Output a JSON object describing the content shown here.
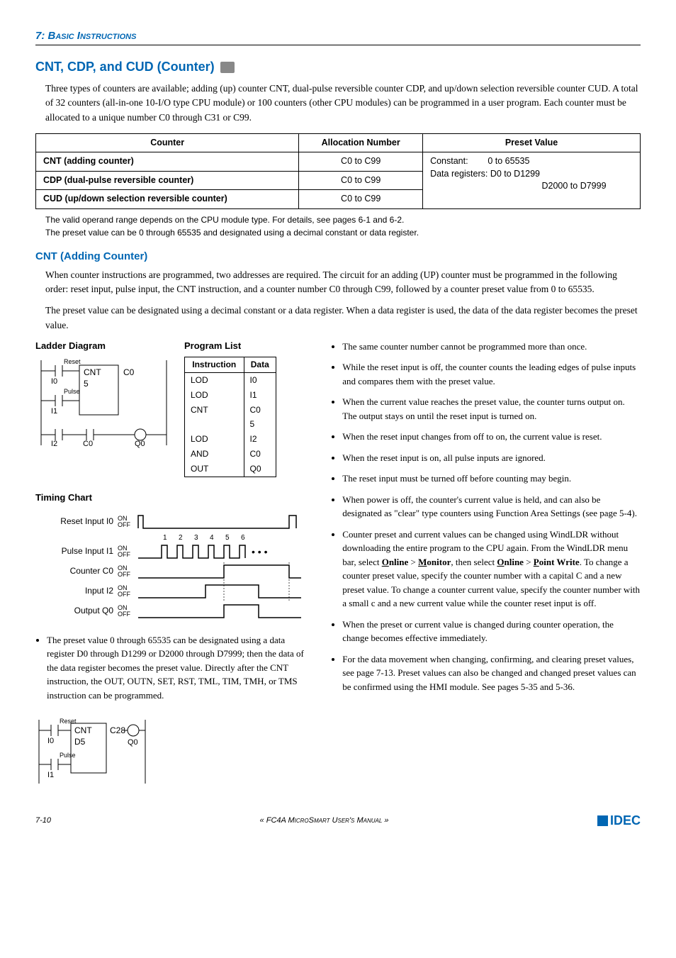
{
  "header": {
    "section_number": "7:",
    "section_title": "Basic Instructions"
  },
  "title": "CNT, CDP, and CUD (Counter)",
  "intro": "Three types of counters are available; adding (up) counter CNT, dual-pulse reversible counter CDP, and up/down selection reversible counter CUD. A total of 32 counters (all-in-one 10-I/O type CPU module) or 100 counters (other CPU modules) can be programmed in a user program. Each counter must be allocated to a unique number C0 through C31 or C99.",
  "counter_table": {
    "headers": [
      "Counter",
      "Allocation Number",
      "Preset Value"
    ],
    "rows": [
      {
        "counter": "CNT (adding counter)",
        "alloc": "C0 to C99"
      },
      {
        "counter": "CDP (dual-pulse reversible counter)",
        "alloc": "C0 to C99"
      },
      {
        "counter": "CUD (up/down selection reversible counter)",
        "alloc": "C0 to C99"
      }
    ],
    "preset_lines": [
      "Constant:        0 to 65535",
      "Data registers: D0 to D1299",
      "D2000 to D7999"
    ]
  },
  "valid_note_1": "The valid operand range depends on the CPU module type. For details, see pages 6-1 and 6-2.",
  "valid_note_2": "The preset value can be 0 through 65535 and designated using a decimal constant or data register.",
  "subhead": "CNT (Adding Counter)",
  "subbody_1": "When counter instructions are programmed, two addresses are required. The circuit for an adding (UP) counter must be programmed in the following order: reset input, pulse input, the CNT instruction, and a counter number C0 through C99, followed by a counter preset value from 0 to 65535.",
  "subbody_2": "The preset value can be designated using a decimal constant or a data register. When a data register is used, the data of the data register becomes the preset value.",
  "ladder_head": "Ladder Diagram",
  "plist_head": "Program List",
  "plist": {
    "headers": [
      "Instruction",
      "Data"
    ],
    "rows": [
      {
        "i": "LOD",
        "d": "I0"
      },
      {
        "i": "LOD",
        "d": "I1"
      },
      {
        "i": "CNT",
        "d": "C0"
      },
      {
        "i": "",
        "d": "5"
      },
      {
        "i": "LOD",
        "d": "I2"
      },
      {
        "i": "AND",
        "d": "C0"
      },
      {
        "i": "OUT",
        "d": "Q0"
      }
    ]
  },
  "ladder1_labels": {
    "reset": "Reset",
    "pulse": "Pulse",
    "i0": "I0",
    "i1": "I1",
    "i2": "I2",
    "cnt": "CNT",
    "c0_right": "C0",
    "c0_bottom": "C0",
    "five": "5",
    "q0": "Q0"
  },
  "timing_head": "Timing Chart",
  "timing_rows": [
    "Reset Input I0",
    "Pulse Input I1",
    "Counter C0",
    "Input I2",
    "Output Q0"
  ],
  "timing_onoff": {
    "on": "ON",
    "off": "OFF"
  },
  "timing_numbers": [
    "1",
    "2",
    "3",
    "4",
    "5",
    "6"
  ],
  "left_bullet": "The preset value 0 through 65535 can be designated using a data register D0 through D1299 or D2000 through D7999; then the data of the data register becomes the preset value. Directly after the CNT instruction, the OUT, OUTN, SET, RST, TML, TIM, TMH, or TMS instruction can be programmed.",
  "ladder2_labels": {
    "reset": "Reset",
    "pulse": "Pulse",
    "i0": "I0",
    "i1": "I1",
    "cnt": "CNT",
    "c28": "C28",
    "d5": "D5",
    "q0": "Q0"
  },
  "right_bullets": [
    "The same counter number cannot be programmed more than once.",
    "While the reset input is off, the counter counts the leading edges of pulse inputs and compares them with the preset value.",
    "When the current value reaches the preset value, the counter turns output on. The output stays on until the reset input is turned on.",
    "When the reset input changes from off to on, the current value is reset.",
    "When the reset input is on, all pulse inputs are ignored.",
    "The reset input must be turned off before counting may begin.",
    "When power is off, the counter's current value is held, and can also be designated as \"clear\" type counters using Function Area Settings (see page 5-4).",
    "Counter preset and current values can be changed using WindLDR without downloading the entire program to the CPU again. From the WindLDR menu bar, select Online > Monitor, then select Online > Point Write. To change a counter preset value, specify the counter number with a capital C and a new preset value. To change a counter current value, specify the counter number with a small c and a new current value while the counter reset input is off.",
    "When the preset or current value is changed during counter operation, the change becomes effective immediately.",
    "For the data movement when changing, confirming, and clearing preset values, see page 7-13. Preset values can also be changed and changed preset values can be confirmed using the HMI module. See pages 5-35 and 5-36."
  ],
  "footer": {
    "page": "7-10",
    "center": "« FC4A MicroSmart User's Manual »",
    "logo": "IDEC"
  }
}
